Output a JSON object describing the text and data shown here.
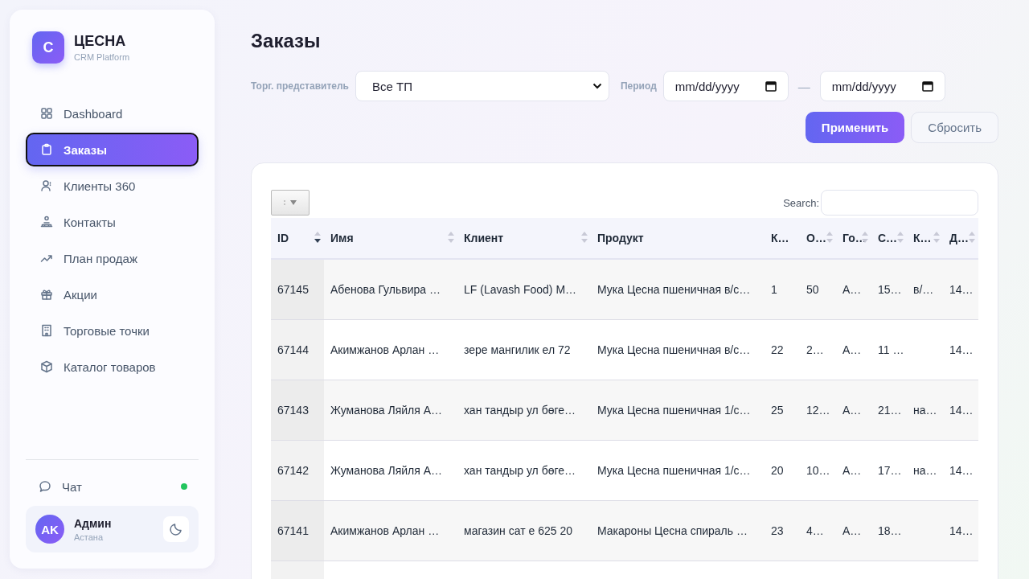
{
  "brand": {
    "logo": "C",
    "name": "ЦЕСНА",
    "subtitle": "CRM Platform"
  },
  "nav": [
    {
      "label": "Dashboard",
      "selected": false
    },
    {
      "label": "Заказы",
      "selected": true
    },
    {
      "label": "Клиенты 360",
      "selected": false
    },
    {
      "label": "Контакты",
      "selected": false
    },
    {
      "label": "План продаж",
      "selected": false
    },
    {
      "label": "Акции",
      "selected": false
    },
    {
      "label": "Торговые точки",
      "selected": false
    },
    {
      "label": "Каталог товаров",
      "selected": false
    }
  ],
  "chat": {
    "label": "Чат",
    "online": true
  },
  "user": {
    "initials": "AK",
    "name": "Админ",
    "city": "Астана"
  },
  "title": "Заказы",
  "filters": {
    "rep_label": "Торг. представитель",
    "rep_value": "Все ТП",
    "period_label": "Период",
    "date_from": {
      "placeholder": "mm/dd/yyyy"
    },
    "separator": "—",
    "date_to": {
      "placeholder": "mm/dd/yyyy"
    }
  },
  "buttons": [
    {
      "label": "Применить",
      "kind": "primary"
    },
    {
      "label": "Сбросить",
      "kind": "secondary"
    }
  ],
  "table": {
    "search_label": "Search:",
    "columns": [
      {
        "label": "ID",
        "sortable": true,
        "sorted": true
      },
      {
        "label": "Имя",
        "sortable": true,
        "sorted": false
      },
      {
        "label": "Клиент",
        "sortable": true,
        "sorted": false
      },
      {
        "label": "Продукт",
        "sortable": false
      },
      {
        "label": "К…",
        "sortable": false
      },
      {
        "label": "О…",
        "sortable": true,
        "sorted": false
      },
      {
        "label": "Го…",
        "sortable": true,
        "sorted": false
      },
      {
        "label": "С…",
        "sortable": true,
        "sorted": false
      },
      {
        "label": "К…",
        "sortable": true,
        "sorted": false
      },
      {
        "label": "Д…",
        "sortable": true,
        "sorted": false
      }
    ],
    "rows": [
      [
        "67145",
        "Абенова Гульвира …",
        "LF (Lavash Food) M…",
        "Мука Цесна пшеничная в/с…",
        "1",
        "50",
        "А…",
        "15…",
        "в/…",
        "14…"
      ],
      [
        "67144",
        "Акимжанов Арлан …",
        "зере мангилик ел 72",
        "Мука Цесна пшеничная в/с…",
        "22",
        "2…",
        "А…",
        "11 …",
        "",
        "14…"
      ],
      [
        "67143",
        "Жуманова Ляйля А…",
        "хан тандыр ул бөге…",
        "Мука Цесна пшеничная 1/с…",
        "25",
        "12…",
        "А…",
        "21…",
        "на…",
        "14…"
      ],
      [
        "67142",
        "Жуманова Ляйля А…",
        "хан тандыр ул бөге…",
        "Мука Цесна пшеничная 1/с…",
        "20",
        "10…",
        "А…",
        "17…",
        "на…",
        "14…"
      ],
      [
        "67141",
        "Акимжанов Арлан …",
        "магазин сат е 625 20",
        "Макароны Цесна спираль …",
        "23",
        "4…",
        "А…",
        "18…",
        "",
        "14…"
      ]
    ]
  }
}
